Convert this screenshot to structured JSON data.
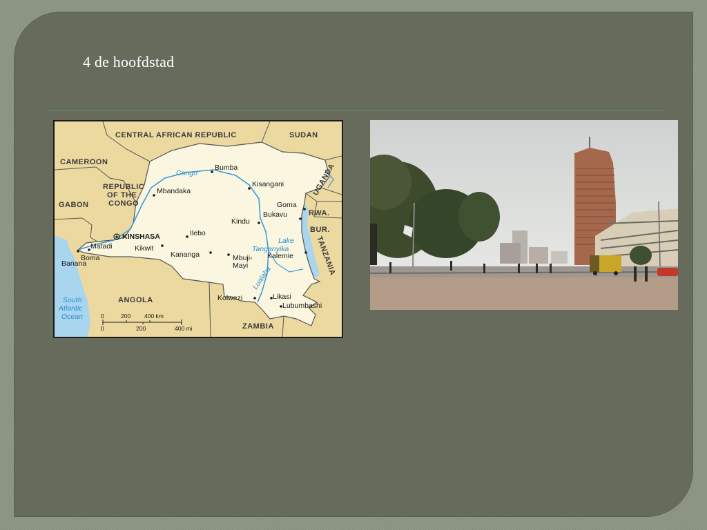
{
  "slide": {
    "title": "4 de hoofdstad"
  },
  "map": {
    "countries": {
      "car": "CENTRAL AFRICAN REPUBLIC",
      "sudan": "SUDAN",
      "cameroon": "CAMEROON",
      "roc_1": "REPUBLIC",
      "roc_2": "OF THE",
      "roc_3": "CONGO",
      "gabon": "GABON",
      "angola": "ANGOLA",
      "zambia": "ZAMBIA",
      "uganda": "UGANDA",
      "rwanda": "RWA.",
      "burundi": "BUR.",
      "tanzania": "TANZANIA"
    },
    "cities": {
      "bumba": "Bumba",
      "kisangani": "Kisangani",
      "mbandaka": "Mbandaka",
      "goma": "Goma",
      "bukavu": "Bukavu",
      "kindu": "Kindu",
      "kinshasa": "KINSHASA",
      "ilebo": "Ilebo",
      "matadi": "Matadi",
      "boma": "Boma",
      "banana": "Banana",
      "kikwit": "Kikwit",
      "kananga": "Kananga",
      "mbujimayi_1": "Mbuji-",
      "mbujimayi_2": "Mayi",
      "kalemie": "Kalemie",
      "kolwezi": "Kolwezi",
      "likasi": "Likasi",
      "lubumbashi": "Lubumbashi"
    },
    "water": {
      "congo": "Congo",
      "lake_1": "Lake",
      "lake_2": "Tanganyika",
      "lualaba": "Lualaba",
      "ocean_1": "South",
      "ocean_2": "Atlantic",
      "ocean_3": "Ocean"
    },
    "scale": {
      "km_0": "0",
      "km_200": "200",
      "km_400": "400 km",
      "mi_0": "0",
      "mi_200": "200",
      "mi_400": "400 mi"
    },
    "colors": {
      "land_drc": "#fbf6df",
      "land_other": "#ecd9a0",
      "water": "#a9d5ef",
      "river": "#3a9ad8",
      "border": "#555555"
    }
  },
  "photo": {
    "subject": "street-scene-kinshasa"
  }
}
